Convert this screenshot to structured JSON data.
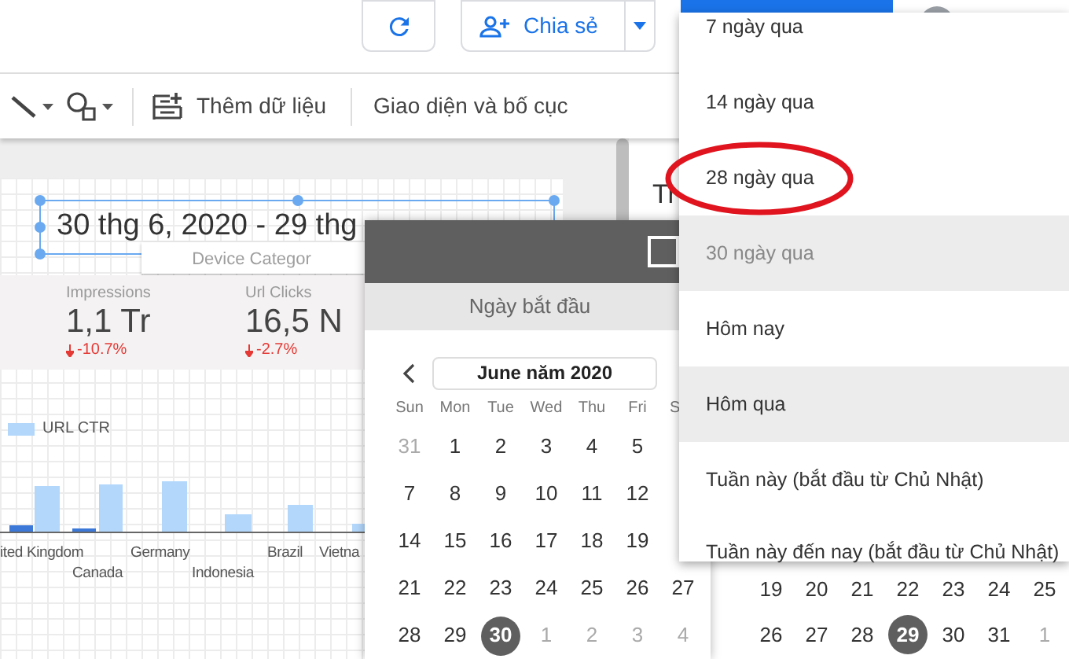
{
  "header": {
    "share_button": "Chia sẻ"
  },
  "toolbar": {
    "items": [
      {
        "kind": "line_tool"
      },
      {
        "kind": "shape_tool"
      },
      {
        "kind": "add_data",
        "label": "Thêm dữ liệu"
      },
      {
        "kind": "theme",
        "label": "Giao diện và bố cục"
      }
    ]
  },
  "report": {
    "date_range": "30 thg 6, 2020 - 29 thg",
    "filter_label": "Device Categor",
    "scorecards": [
      {
        "label": "Impressions",
        "value": "1,1 Tr",
        "change": "-10.7%"
      },
      {
        "label": "Url Clicks",
        "value": "16,5 N",
        "change": "-2.7%"
      }
    ],
    "chart": {
      "legend": "URL CTR",
      "x_labels": [
        "ited Kingdom",
        "Canada",
        "Germany",
        "Indonesia",
        "Brazil",
        "Vietna"
      ]
    }
  },
  "side_panel": {
    "title": "Tr"
  },
  "date_dialog": {
    "tab": "Ngày bắt đầu",
    "month": "June năm 2020",
    "weekdays": [
      "Sun",
      "Mon",
      "Tue",
      "Wed",
      "Thu",
      "Fri",
      "S"
    ],
    "weeks": [
      [
        {
          "d": "31",
          "muted": true,
          "selected": false
        },
        {
          "d": "1",
          "muted": false,
          "selected": false
        },
        {
          "d": "2",
          "muted": false,
          "selected": false
        },
        {
          "d": "3",
          "muted": false,
          "selected": false
        },
        {
          "d": "4",
          "muted": false,
          "selected": false
        },
        {
          "d": "5",
          "muted": false,
          "selected": false
        }
      ],
      [
        {
          "d": "7",
          "muted": false,
          "selected": false
        },
        {
          "d": "8",
          "muted": false,
          "selected": false
        },
        {
          "d": "9",
          "muted": false,
          "selected": false
        },
        {
          "d": "10",
          "muted": false,
          "selected": false
        },
        {
          "d": "11",
          "muted": false,
          "selected": false
        },
        {
          "d": "12",
          "muted": false,
          "selected": false
        }
      ],
      [
        {
          "d": "14",
          "muted": false,
          "selected": false
        },
        {
          "d": "15",
          "muted": false,
          "selected": false
        },
        {
          "d": "16",
          "muted": false,
          "selected": false
        },
        {
          "d": "17",
          "muted": false,
          "selected": false
        },
        {
          "d": "18",
          "muted": false,
          "selected": false
        },
        {
          "d": "19",
          "muted": false,
          "selected": false
        }
      ],
      [
        {
          "d": "21",
          "muted": false,
          "selected": false
        },
        {
          "d": "22",
          "muted": false,
          "selected": false
        },
        {
          "d": "23",
          "muted": false,
          "selected": false
        },
        {
          "d": "24",
          "muted": false,
          "selected": false
        },
        {
          "d": "25",
          "muted": false,
          "selected": false
        },
        {
          "d": "26",
          "muted": false,
          "selected": false
        },
        {
          "d": "27",
          "muted": false,
          "selected": false
        }
      ],
      [
        {
          "d": "28",
          "muted": false,
          "selected": false
        },
        {
          "d": "29",
          "muted": false,
          "selected": false
        },
        {
          "d": "30",
          "muted": false,
          "selected": true
        },
        {
          "d": "1",
          "muted": true,
          "selected": false
        },
        {
          "d": "2",
          "muted": true,
          "selected": false
        },
        {
          "d": "3",
          "muted": true,
          "selected": false
        },
        {
          "d": "4",
          "muted": true,
          "selected": false
        }
      ]
    ]
  },
  "end_calendar": {
    "weeks": [
      [
        {
          "d": "19",
          "muted": false,
          "selected": false
        },
        {
          "d": "20",
          "muted": false,
          "selected": false
        },
        {
          "d": "21",
          "muted": false,
          "selected": false
        },
        {
          "d": "22",
          "muted": false,
          "selected": false
        },
        {
          "d": "23",
          "muted": false,
          "selected": false
        },
        {
          "d": "24",
          "muted": false,
          "selected": false
        },
        {
          "d": "25",
          "muted": false,
          "selected": false
        }
      ],
      [
        {
          "d": "26",
          "muted": false,
          "selected": false
        },
        {
          "d": "27",
          "muted": false,
          "selected": false
        },
        {
          "d": "28",
          "muted": false,
          "selected": false
        },
        {
          "d": "29",
          "muted": false,
          "selected": true
        },
        {
          "d": "30",
          "muted": false,
          "selected": false
        },
        {
          "d": "31",
          "muted": false,
          "selected": false
        },
        {
          "d": "1",
          "muted": true,
          "selected": false
        }
      ]
    ]
  },
  "preset_menu": {
    "items": [
      {
        "label": "7 ngày qua",
        "selected": false,
        "hovered": false,
        "circled": false
      },
      {
        "label": "14 ngày qua",
        "selected": false,
        "hovered": false,
        "circled": false
      },
      {
        "label": "28 ngày qua",
        "selected": false,
        "hovered": false,
        "circled": true
      },
      {
        "label": "30 ngày qua",
        "selected": true,
        "hovered": false,
        "circled": false
      },
      {
        "label": "Hôm nay",
        "selected": false,
        "hovered": false,
        "circled": false
      },
      {
        "label": "Hôm qua",
        "selected": false,
        "hovered": true,
        "circled": false
      },
      {
        "label": "Tuần này (bắt đầu từ Chủ Nhật)",
        "selected": false,
        "hovered": false,
        "circled": false
      },
      {
        "label": "Tuần này đến nay (bắt đầu từ Chủ Nhật)",
        "selected": false,
        "hovered": false,
        "circled": false
      }
    ]
  }
}
